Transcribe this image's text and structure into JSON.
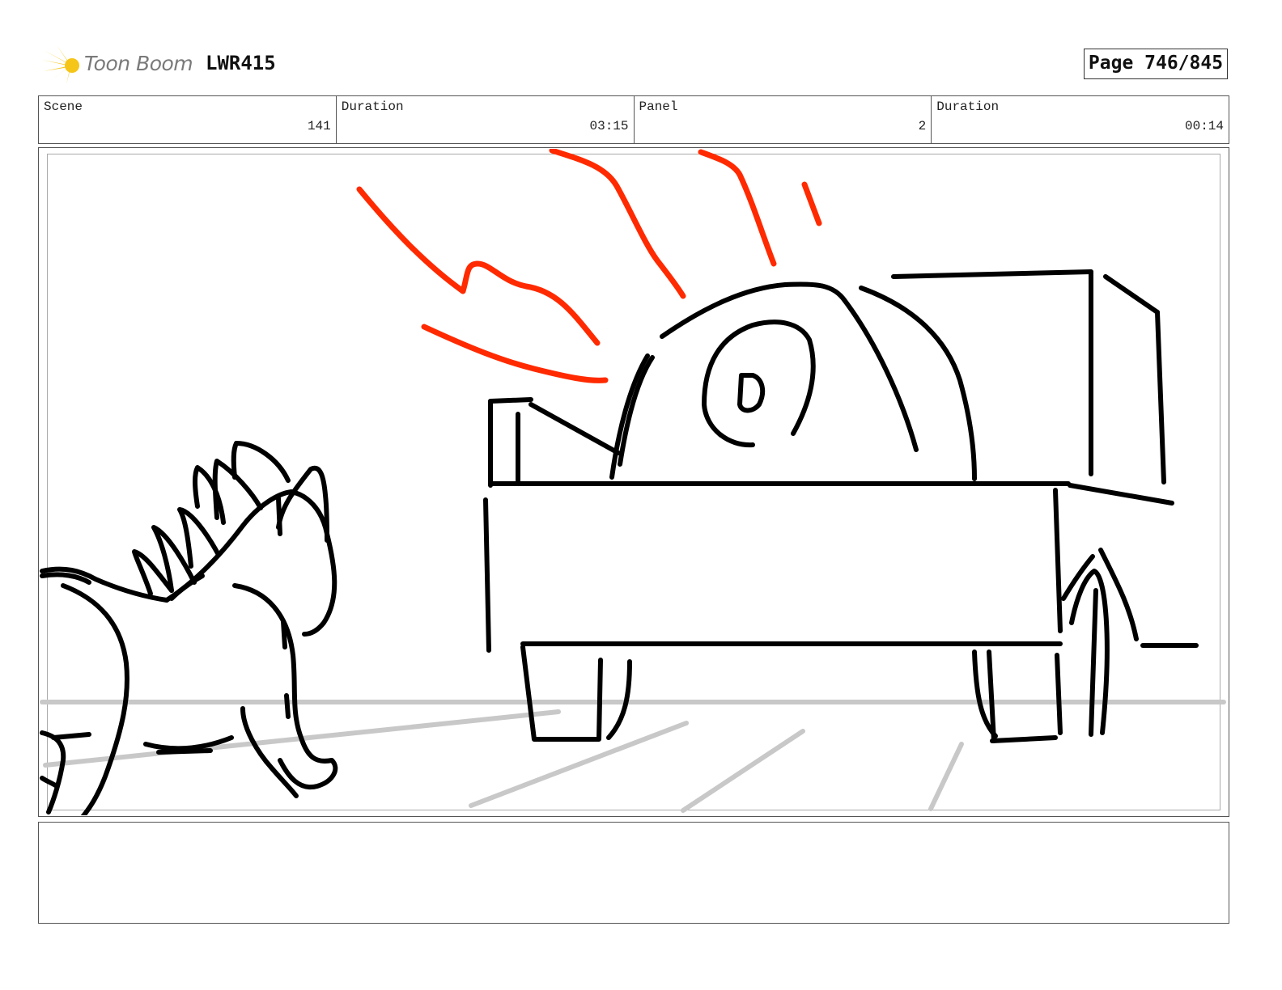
{
  "header": {
    "logo_text": "Toon Boom",
    "project_code": "LWR415",
    "page_label": "Page 746/845"
  },
  "info": {
    "scene_label": "Scene",
    "scene_value": "141",
    "scene_duration_label": "Duration",
    "scene_duration_value": "03:15",
    "panel_label": "Panel",
    "panel_value": "2",
    "panel_duration_label": "Duration",
    "panel_duration_value": "00:14"
  },
  "colors": {
    "logo_yellow": "#f5c518",
    "ink": "#000000",
    "accent_red": "#ff2a00",
    "guide_gray": "#c8c8c8"
  },
  "notes": {
    "text": ""
  }
}
